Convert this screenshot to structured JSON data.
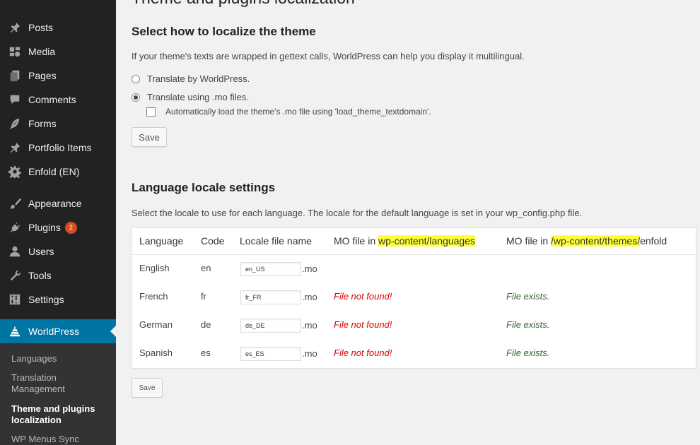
{
  "sidebar": {
    "items": [
      {
        "label": "Posts",
        "icon": "pin-icon"
      },
      {
        "label": "Media",
        "icon": "media-icon"
      },
      {
        "label": "Pages",
        "icon": "pages-icon"
      },
      {
        "label": "Comments",
        "icon": "comment-icon"
      },
      {
        "label": "Forms",
        "icon": "feather-icon"
      },
      {
        "label": "Portfolio Items",
        "icon": "pin-icon"
      },
      {
        "label": "Enfold (EN)",
        "icon": "gear-icon"
      },
      {
        "label": "Appearance",
        "icon": "brush-icon"
      },
      {
        "label": "Plugins",
        "icon": "plug-icon",
        "badge": "2"
      },
      {
        "label": "Users",
        "icon": "user-icon"
      },
      {
        "label": "Tools",
        "icon": "wrench-icon"
      },
      {
        "label": "Settings",
        "icon": "settings-icon"
      }
    ],
    "active": {
      "label": "WorldPress",
      "icon": "worldpress-icon"
    },
    "submenu": [
      {
        "label": "Languages"
      },
      {
        "label": "Translation Management"
      },
      {
        "label": "Theme and plugins localization"
      },
      {
        "label": "WP Menus Sync"
      }
    ]
  },
  "main": {
    "page_title": "Theme and plugins localization",
    "theme_section": {
      "heading": "Select how to localize the theme",
      "description": "If your theme's texts are wrapped in gettext calls, WorldPress can help you display it multilingual.",
      "options": [
        {
          "label": "Translate by WorldPress.",
          "checked": false
        },
        {
          "label": "Translate using .mo files.",
          "checked": true
        }
      ],
      "checkbox_label": "Automatically load the theme's .mo file using 'load_theme_textdomain'.",
      "save_label": "Save"
    },
    "locale_section": {
      "heading": "Language locale settings",
      "description": "Select the locale to use for each language. The locale for the default language is set in your wp_config.php file.",
      "columns": {
        "language": "Language",
        "code": "Code",
        "locale": "Locale file name",
        "mo_lang_prefix": "MO file in ",
        "mo_lang_path": "wp-content/languages",
        "mo_theme_prefix": "MO file in ",
        "mo_theme_path": "/wp-content/themes/",
        "mo_theme_suffix": "enfold"
      },
      "rows": [
        {
          "language": "English",
          "code": "en",
          "locale": "en_US",
          "ext": ".mo",
          "mo_lang": "",
          "mo_theme": ""
        },
        {
          "language": "French",
          "code": "fr",
          "locale": "fr_FR",
          "ext": ".mo",
          "mo_lang": "File not found!",
          "mo_theme": "File exists."
        },
        {
          "language": "German",
          "code": "de",
          "locale": "de_DE",
          "ext": ".mo",
          "mo_lang": "File not found!",
          "mo_theme": "File exists."
        },
        {
          "language": "Spanish",
          "code": "es",
          "locale": "es_ES",
          "ext": ".mo",
          "mo_lang": "File not found!",
          "mo_theme": "File exists."
        }
      ],
      "save_label": "Save"
    }
  },
  "colors": {
    "sidebar_bg": "#222222",
    "active_bg": "#0074a2",
    "highlight": "#ffff3b",
    "not_found": "#dd0000",
    "exists": "#336633"
  }
}
